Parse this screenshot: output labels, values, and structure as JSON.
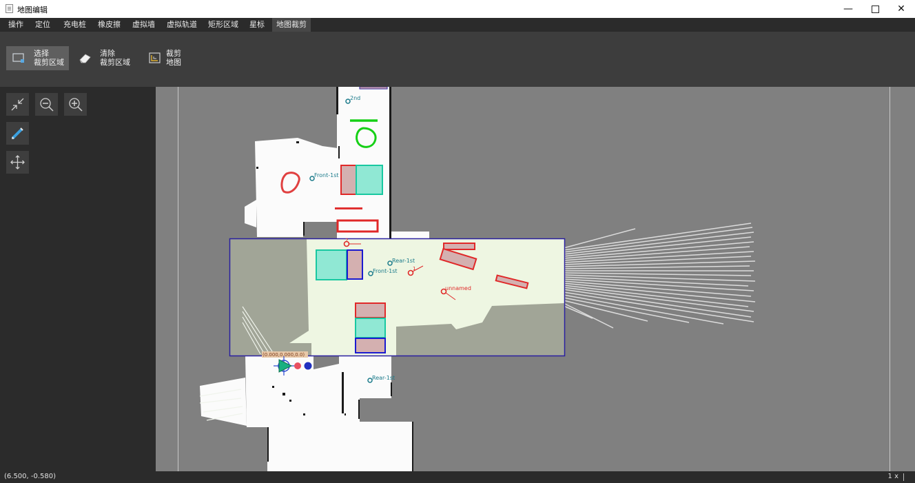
{
  "window": {
    "title": "地图编辑",
    "minimize": "—",
    "close": "✕"
  },
  "menu": {
    "items": [
      "操作",
      "定位",
      "充电桩",
      "橡皮擦",
      "虚拟墙",
      "虚拟轨道",
      "矩形区域",
      "星标",
      "地图裁剪"
    ],
    "active_index": 8
  },
  "toolbar": {
    "select_crop": {
      "line1": "选择",
      "line2": "裁剪区域",
      "icon": "select-rect-icon"
    },
    "clear_crop": {
      "line1": "清除",
      "line2": "裁剪区域",
      "icon": "eraser-icon"
    },
    "crop_map": {
      "line1": "裁剪",
      "line2": "地图",
      "icon": "crop-icon"
    }
  },
  "side_tools": [
    "fit-icon",
    "zoom-out-icon",
    "zoom-in-icon",
    "pen-tool-icon",
    "move-icon"
  ],
  "map": {
    "markers": {
      "second": "2nd",
      "front_1st_a": "Front-1st",
      "rear_1st_a": "Rear-1st",
      "front_1st_b": "Front-1st",
      "rear_1st_b": "Rear-1st"
    },
    "poi": {
      "red_1": "2",
      "red_2": "1",
      "unnamed": "unnamed"
    },
    "robot_pose": "(0.000,0.000,0.0)"
  },
  "status": {
    "cursor": "(6.500, -0.580)",
    "zoom": "1 x"
  },
  "colors": {
    "crop_rect": "#2a1fa0",
    "red_zone": "#e02828",
    "cyan_zone": "#18c8a0",
    "blue_zone": "#1a1ad0",
    "green_line": "#16d016",
    "marker": "#1a7a8a"
  }
}
